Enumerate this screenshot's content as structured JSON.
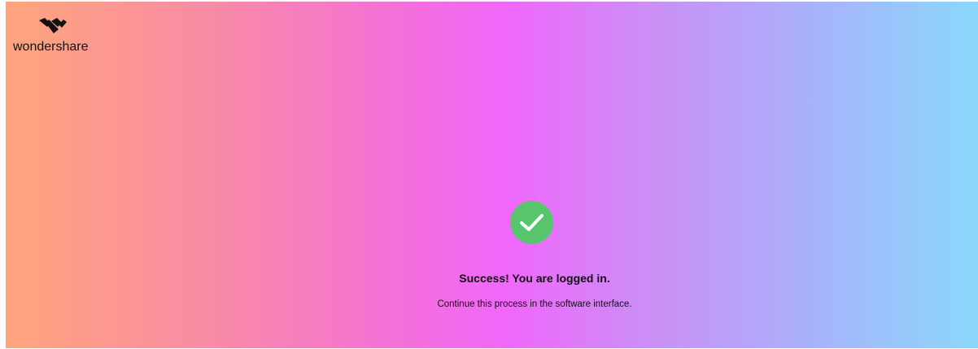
{
  "brand": {
    "name": "wondershare",
    "icon": "wondershare-logo-icon"
  },
  "status": {
    "icon": "check-circle-icon",
    "icon_color": "#56c56c",
    "title": "Success! You are logged in.",
    "message": "Continue this process in the software interface."
  },
  "background": {
    "gradient_colors": [
      "#ffa57b",
      "#f88aa8",
      "#ef68fb",
      "#aab0fb",
      "#8bd7fb"
    ]
  }
}
